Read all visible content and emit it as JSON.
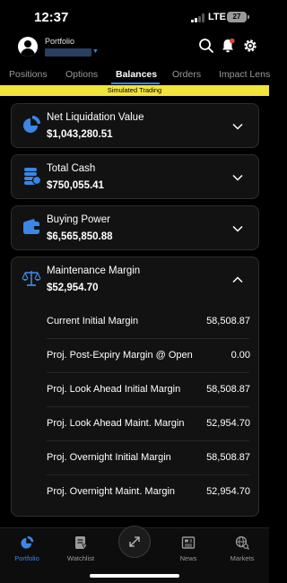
{
  "status": {
    "time": "12:37",
    "network": "LTE",
    "battery": "27"
  },
  "header": {
    "portfolio_label": "Portfolio"
  },
  "tabs": [
    {
      "label": "Positions"
    },
    {
      "label": "Options"
    },
    {
      "label": "Balances",
      "active": true
    },
    {
      "label": "Orders"
    },
    {
      "label": "Impact Lens"
    }
  ],
  "banner": "Simulated Trading",
  "cards": {
    "net_liq": {
      "title": "Net Liquidation Value",
      "value": "$1,043,280.51",
      "icon": "pie-chart-icon"
    },
    "total_cash": {
      "title": "Total Cash",
      "value": "$750,055.41",
      "icon": "coins-icon"
    },
    "buying_power": {
      "title": "Buying Power",
      "value": "$6,565,850.88",
      "icon": "wallet-icon"
    },
    "maint_margin": {
      "title": "Maintenance Margin",
      "value": "$52,954.70",
      "icon": "scales-icon",
      "expanded": true,
      "rows": [
        {
          "label": "Current Initial Margin",
          "value": "58,508.87"
        },
        {
          "label": "Proj. Post-Expiry Margin @ Open",
          "value": "0.00"
        },
        {
          "label": "Proj. Look Ahead Initial Margin",
          "value": "58,508.87"
        },
        {
          "label": "Proj. Look Ahead Maint. Margin",
          "value": "52,954.70"
        },
        {
          "label": "Proj. Overnight Initial Margin",
          "value": "58,508.87"
        },
        {
          "label": "Proj. Overnight Maint. Margin",
          "value": "52,954.70"
        }
      ]
    }
  },
  "nav": [
    {
      "label": "Portfolio",
      "icon": "pie-chart-icon",
      "active": true
    },
    {
      "label": "Watchlist",
      "icon": "watchlist-icon"
    },
    {
      "label": "",
      "icon": "expand-arrows-icon"
    },
    {
      "label": "News",
      "icon": "newspaper-icon"
    },
    {
      "label": "Markets",
      "icon": "globe-search-icon"
    }
  ],
  "colors": {
    "accent": "#3b86e6",
    "banner": "#f2e43a",
    "card_bg": "#121212",
    "background": "#000000",
    "notification": "#e5413a"
  }
}
